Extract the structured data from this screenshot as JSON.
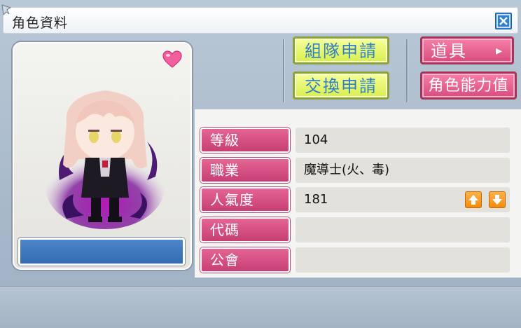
{
  "window": {
    "title": "角色資料"
  },
  "buttons": {
    "party_request": "組隊申請",
    "trade_request": "交換申請",
    "items": "道具",
    "items_arrow": "▸",
    "character_stats": "角色能力值"
  },
  "info_rows": [
    {
      "label": "等級",
      "value": "104"
    },
    {
      "label": "職業",
      "value": "魔導士(火、毒)"
    },
    {
      "label": "人氣度",
      "value": "181"
    },
    {
      "label": "代碼",
      "value": ""
    },
    {
      "label": "公會",
      "value": ""
    }
  ],
  "colors": {
    "accent_yellow": "#d8ef4c",
    "accent_pink": "#d84c7d",
    "label_pink": "#c73e73",
    "name_bar_blue": "#356bb0",
    "fame_button_orange": "#f48a0e"
  },
  "icons": {
    "close": "close-icon",
    "heart": "heart-icon",
    "fame_up": "arrow-up-icon",
    "fame_down": "arrow-down-icon"
  }
}
